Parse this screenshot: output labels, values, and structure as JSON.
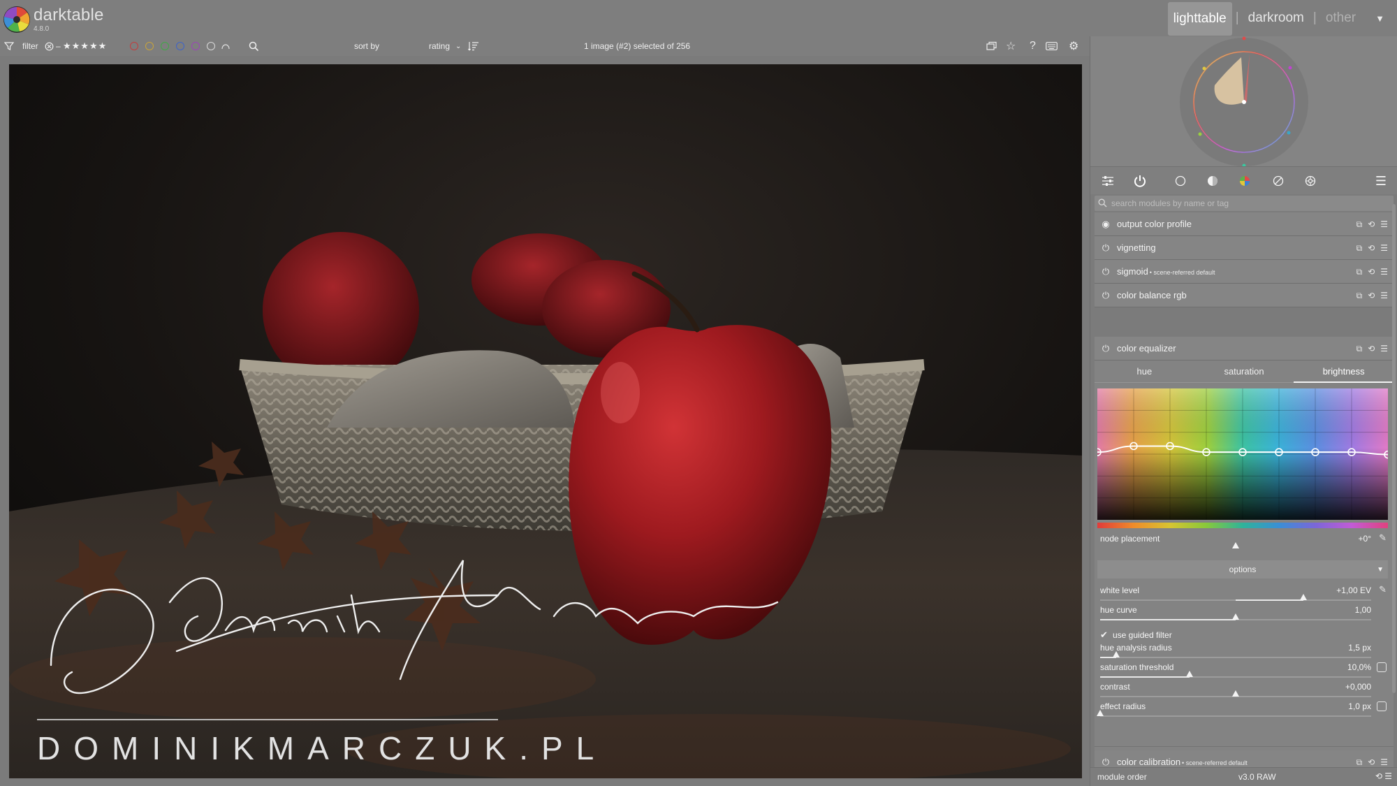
{
  "app": {
    "name": "darktable",
    "version": "4.8.0"
  },
  "views": {
    "lighttable": "lighttable",
    "darkroom": "darkroom",
    "other": "other",
    "separator": "|"
  },
  "filterbar": {
    "filter_label": "filter",
    "stars": "★★★★★",
    "sort_by_label": "sort by",
    "sort_value": "rating",
    "search_placeholder": "",
    "selection_status": "1 image (#2) selected of 256"
  },
  "color_labels": [
    "#c23d3d",
    "#c9a43a",
    "#3faa45",
    "#3d63c9",
    "#9c44b9"
  ],
  "photo": {
    "watermark_signature": "Dominik Marczuk",
    "watermark_url": "DOMINIKMARCZUK.PL"
  },
  "right_panel": {
    "module_search_placeholder": "search modules by name or tag",
    "modules_top": [
      {
        "name": "output color profile",
        "sub": "",
        "active": false
      },
      {
        "name": "vignetting",
        "sub": "",
        "active": true
      },
      {
        "name": "sigmoid",
        "sub": "• scene-referred default",
        "active": true
      },
      {
        "name": "color balance rgb",
        "sub": "",
        "active": true
      }
    ],
    "color_equalizer": {
      "name": "color equalizer",
      "tabs": [
        "hue",
        "saturation",
        "brightness"
      ],
      "active_tab": "brightness",
      "curve_levels": [
        0.5,
        0.55,
        0.55,
        0.5,
        0.5,
        0.5,
        0.5,
        0.5,
        0.48
      ],
      "node_placement": {
        "label": "node placement",
        "value": "+0°",
        "position": 0.5
      },
      "options_label": "options",
      "sliders": [
        {
          "label": "white level",
          "value": "+1,00 EV",
          "fill_from": 0.5,
          "fill_to": 0.75
        },
        {
          "label": "hue curve",
          "value": "1,00",
          "fill_from": 0.0,
          "fill_to": 0.5
        },
        {
          "label": "hue analysis radius",
          "value": "1,5 px",
          "fill_from": 0.0,
          "fill_to": 0.06
        },
        {
          "label": "saturation threshold",
          "value": "10,0%",
          "fill_from": 0.0,
          "fill_to": 0.33
        },
        {
          "label": "contrast",
          "value": "+0,000",
          "fill_from": 0.5,
          "fill_to": 0.5
        },
        {
          "label": "effect radius",
          "value": "1,0 px",
          "fill_from": 0.0,
          "fill_to": 0.0
        }
      ],
      "guided_filter": {
        "label": "use guided filter",
        "checked": true
      }
    },
    "modules_bottom": [
      {
        "name": "color calibration",
        "sub": "• scene-referred default",
        "active": true
      }
    ],
    "module_order": {
      "label": "module order",
      "value": "v3.0 RAW"
    }
  }
}
